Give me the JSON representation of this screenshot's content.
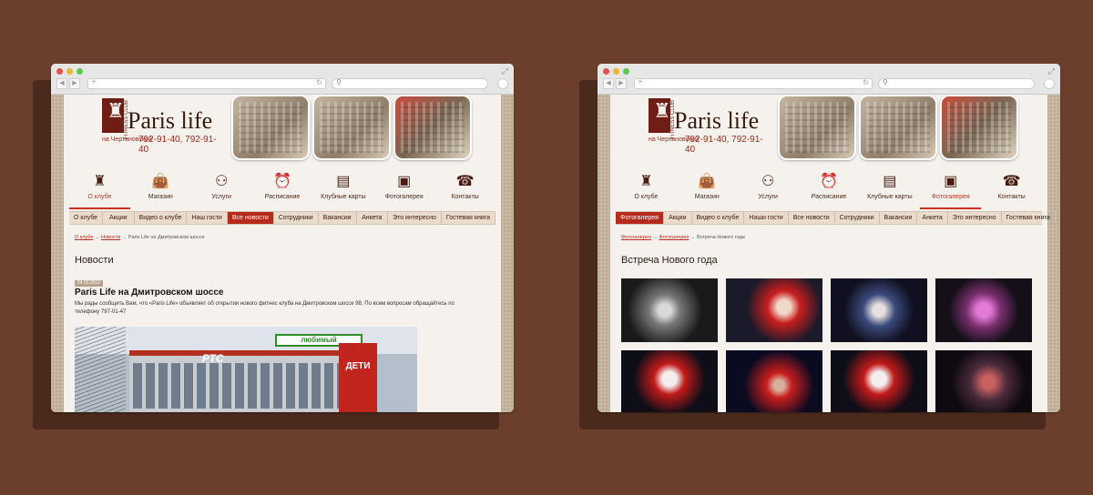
{
  "windows": [
    {
      "logo": {
        "name": "Paris life",
        "side_text": "FITNESS CLUB",
        "location": "на Чертановской",
        "phone": "792-91-40, 792-91-40"
      },
      "nav": [
        {
          "label": "О клубе",
          "icon": "eiffel-tower-icon"
        },
        {
          "label": "Магазин",
          "icon": "shopping-bag-icon"
        },
        {
          "label": "Услуги",
          "icon": "dumbbell-icon"
        },
        {
          "label": "Расписание",
          "icon": "alarm-clock-icon"
        },
        {
          "label": "Клубные карты",
          "icon": "cards-icon"
        },
        {
          "label": "Фотогалерея",
          "icon": "picture-frame-icon"
        },
        {
          "label": "Контакты",
          "icon": "telephone-icon"
        }
      ],
      "subnav": [
        "О клубе",
        "Акции",
        "Видео о клубе",
        "Наш гости",
        "Все новости",
        "Сотрудники",
        "Вакансии",
        "Анкета",
        "Это интересно",
        "Гостевая книга"
      ],
      "breadcrumb": {
        "link1": "О клубе",
        "link2": "Новости",
        "current": "Paris Life на Дмитровском шоссе"
      },
      "title": "Новости",
      "date": "24.03.2012",
      "article_title": "Paris Life на Дмитровском шоссе",
      "article_text": "Мы рады сообщить Вам, что «Paris Life» объявляет об открытии нового фитнес клуба на Дмитровском шоссе 98. По всем вопросам обращайтесь по телефону 797-01-47",
      "photo_sign": "любимый",
      "photo_rts": "РТС",
      "photo_deti": "ДЕТИ"
    },
    {
      "logo": {
        "name": "Paris life",
        "side_text": "FITNESS CLUB",
        "location": "на Чертановской",
        "phone": "792-91-40, 792-91-40"
      },
      "nav": [
        {
          "label": "О клубе",
          "icon": "eiffel-tower-icon"
        },
        {
          "label": "Магазин",
          "icon": "shopping-bag-icon"
        },
        {
          "label": "Услуги",
          "icon": "dumbbell-icon"
        },
        {
          "label": "Расписание",
          "icon": "alarm-clock-icon"
        },
        {
          "label": "Клубные карты",
          "icon": "cards-icon"
        },
        {
          "label": "Фотогалерея",
          "icon": "picture-frame-icon"
        },
        {
          "label": "Контакты",
          "icon": "telephone-icon"
        }
      ],
      "subnav": [
        "Фотогалерея",
        "Акции",
        "Видео о клубе",
        "Наши гости",
        "Все новости",
        "Сотрудники",
        "Вакансии",
        "Анкета",
        "Это интересно",
        "Гостевая книга"
      ],
      "breadcrumb": {
        "link1": "Фотогалерея",
        "link2": "Фотогалерея",
        "current": "Встреча Нового года"
      },
      "title": "Встреча Нового года"
    }
  ],
  "colors": {
    "background": "#6b3f2c",
    "accent": "#b52a1a",
    "brand_dark": "#6e1e14"
  }
}
